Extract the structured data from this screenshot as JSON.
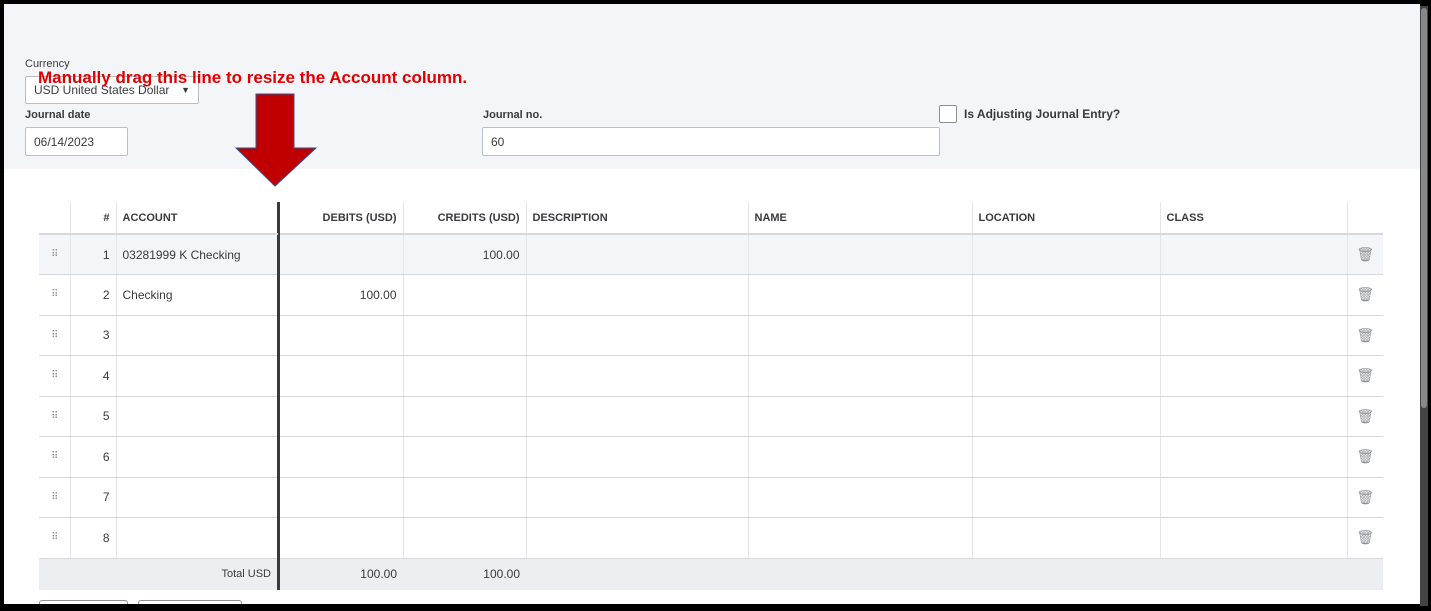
{
  "form": {
    "currency_label": "Currency",
    "currency_value": "USD United States Dollar",
    "journal_date_label": "Journal date",
    "journal_date_value": "06/14/2023",
    "journal_no_label": "Journal no.",
    "journal_no_value": "60",
    "adjusting_label": "Is Adjusting Journal Entry?",
    "adjusting_checked": false
  },
  "annotation": {
    "text": "Manually drag this line to resize the Account column.",
    "color": "#e00000",
    "arrow_color": "#c00000"
  },
  "table": {
    "headers": [
      "#",
      "ACCOUNT",
      "DEBITS (USD)",
      "CREDITS (USD)",
      "DESCRIPTION",
      "NAME",
      "LOCATION",
      "CLASS"
    ],
    "rows": [
      {
        "n": "1",
        "account": "03281999 K Checking",
        "debit": "",
        "credit": "100.00"
      },
      {
        "n": "2",
        "account": "Checking",
        "debit": "100.00",
        "credit": ""
      },
      {
        "n": "3",
        "account": "",
        "debit": "",
        "credit": ""
      },
      {
        "n": "4",
        "account": "",
        "debit": "",
        "credit": ""
      },
      {
        "n": "5",
        "account": "",
        "debit": "",
        "credit": ""
      },
      {
        "n": "6",
        "account": "",
        "debit": "",
        "credit": ""
      },
      {
        "n": "7",
        "account": "",
        "debit": "",
        "credit": ""
      },
      {
        "n": "8",
        "account": "",
        "debit": "",
        "credit": ""
      }
    ],
    "total_label": "Total USD",
    "total_debit": "100.00",
    "total_credit": "100.00"
  }
}
